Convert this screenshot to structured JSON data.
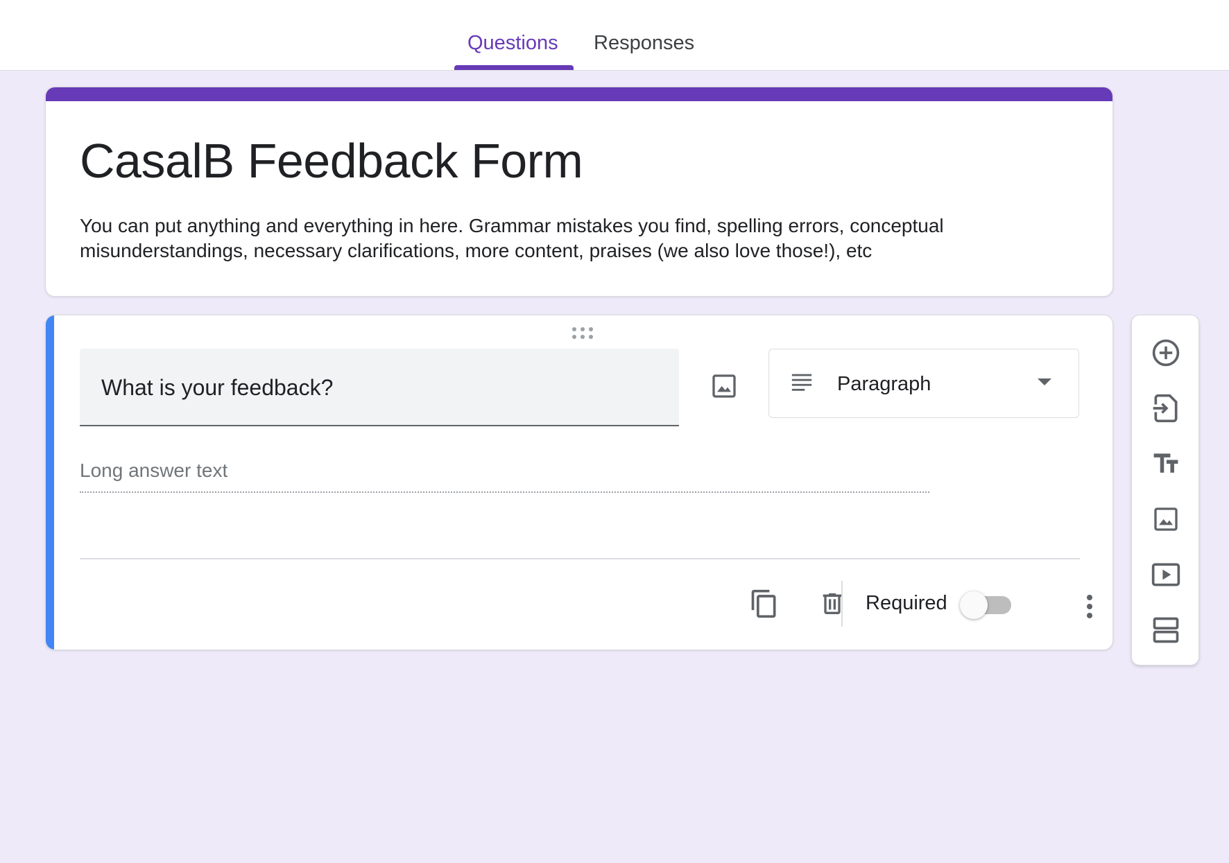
{
  "tabs": {
    "questions_label": "Questions",
    "responses_label": "Responses",
    "active": "Questions"
  },
  "form": {
    "title": "CasalB Feedback Form",
    "description": "You can put anything and everything in here. Grammar mistakes you find, spelling errors, conceptual misunderstandings, necessary clarifications, more content, praises (we also love those!), etc"
  },
  "question": {
    "title": "What is your feedback?",
    "type_label": "Paragraph",
    "type_icon": "paragraph-icon",
    "answer_placeholder": "Long answer text",
    "required_label": "Required",
    "required": false
  },
  "side_toolbar": {
    "icons": [
      "add-question-icon",
      "import-questions-icon",
      "add-title-icon",
      "add-image-icon",
      "add-video-icon",
      "add-section-icon"
    ]
  },
  "colors": {
    "accent": "#673ab7",
    "active_bar": "#4285f4",
    "background": "#efeafa"
  }
}
